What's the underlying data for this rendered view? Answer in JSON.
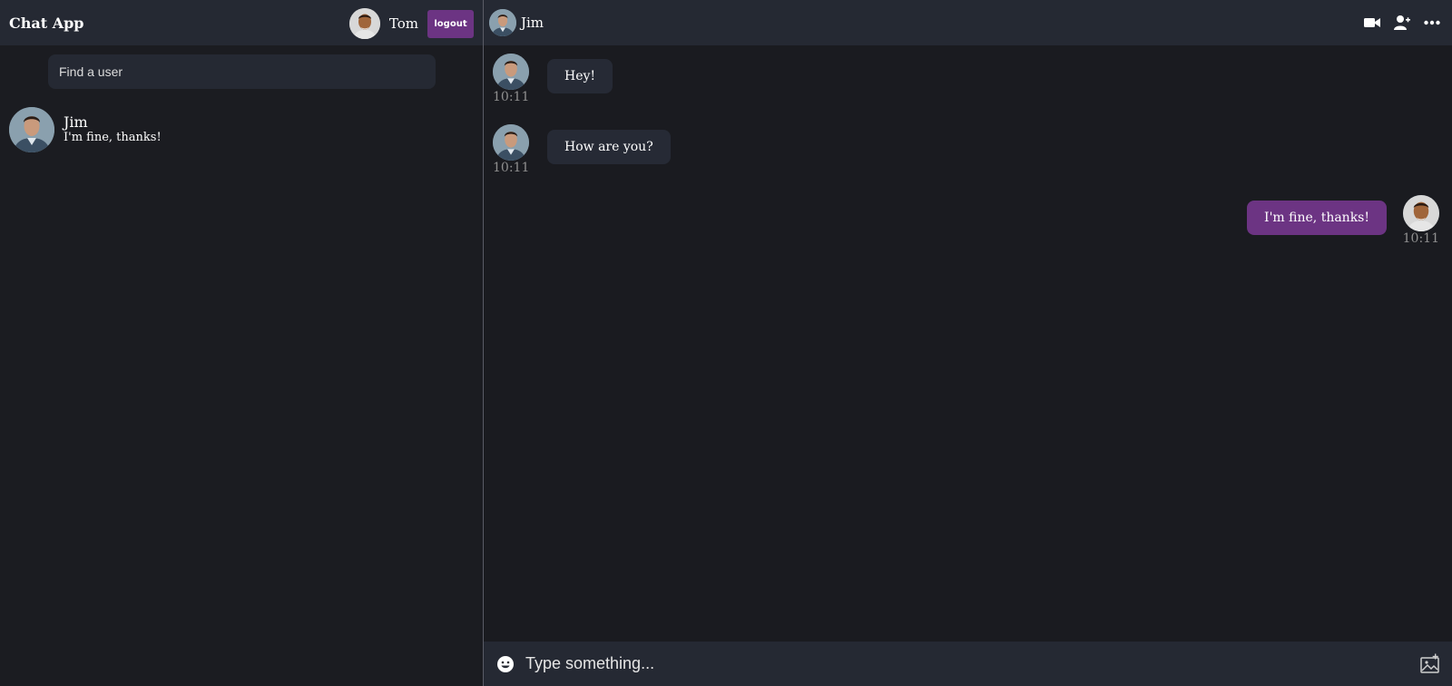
{
  "app": {
    "title": "Chat App"
  },
  "current_user": {
    "name": "Tom",
    "logout_label": "logout"
  },
  "search": {
    "placeholder": "Find a user"
  },
  "chat_list": [
    {
      "name": "Jim",
      "last_message": "I'm fine, thanks!"
    }
  ],
  "active_chat": {
    "name": "Jim"
  },
  "header_icons": [
    "video-camera-icon",
    "add-user-icon",
    "more-options-icon"
  ],
  "messages": [
    {
      "from": "Jim",
      "text": "Hey!",
      "time": "10:11",
      "mine": false
    },
    {
      "from": "Jim",
      "text": "How are you?",
      "time": "10:11",
      "mine": false
    },
    {
      "from": "Tom",
      "text": "I'm fine, thanks!",
      "time": "10:11",
      "mine": true
    }
  ],
  "composer": {
    "placeholder": "Type something..."
  },
  "colors": {
    "accent": "#6c3483",
    "panel": "#252933",
    "background": "#1a1b20",
    "bubble": "#262a35"
  }
}
